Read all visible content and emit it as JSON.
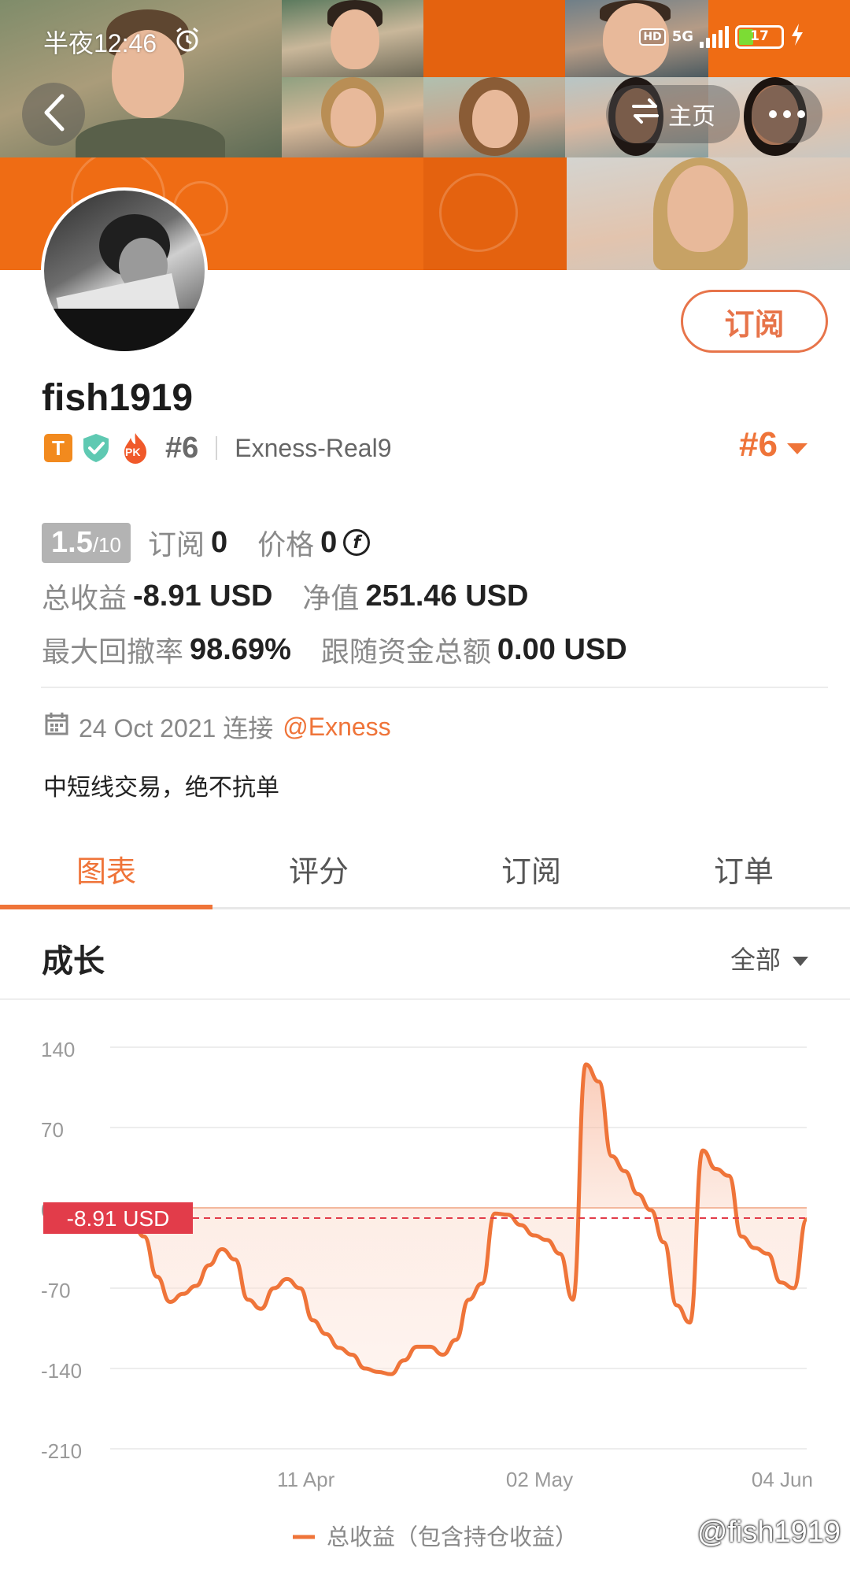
{
  "status_bar": {
    "time": "半夜12:46",
    "network_badge": "HD",
    "network": "5G",
    "battery": "17"
  },
  "nav": {
    "home_label": "主页"
  },
  "profile": {
    "username": "fish1919",
    "badge_t": "T",
    "badge_pk": "PK",
    "rank": "#6",
    "server": "Exness-Real9",
    "rank_big": "#6",
    "subscribe_label": "订阅"
  },
  "stats": {
    "score": "1.5",
    "score_max": "/10",
    "subscriptions_label": "订阅",
    "subscriptions_value": "0",
    "price_label": "价格",
    "price_value": "0",
    "total_profit_label": "总收益",
    "total_profit_value": "-8.91 USD",
    "equity_label": "净值",
    "equity_value": "251.46 USD",
    "max_drawdown_label": "最大回撤率",
    "max_drawdown_value": "98.69%",
    "follow_funds_label": "跟随资金总额",
    "follow_funds_value": "0.00 USD"
  },
  "connect": {
    "date": "24 Oct 2021 连接",
    "broker": "@Exness"
  },
  "bio": "中短线交易，绝不抗单",
  "tabs": [
    {
      "label": "图表",
      "active": true
    },
    {
      "label": "评分",
      "active": false
    },
    {
      "label": "订阅",
      "active": false
    },
    {
      "label": "订单",
      "active": false
    }
  ],
  "section": {
    "title": "成长",
    "range": "全部"
  },
  "chart_data": {
    "type": "area",
    "ylim": [
      -210,
      140
    ],
    "y_ticks": [
      "140",
      "70",
      "0",
      "-70",
      "-140",
      "-210"
    ],
    "x_ticks": [
      "11 Apr",
      "02 May",
      "04 Jun"
    ],
    "current_value_label": "-8.91 USD",
    "current_value": -8.91,
    "legend": "总收益（包含持仓收益）",
    "series": [
      {
        "name": "总收益（包含持仓收益）",
        "values": [
          0,
          -10,
          -25,
          -60,
          -82,
          -75,
          -68,
          -50,
          -36,
          -45,
          -80,
          -88,
          -70,
          -62,
          -70,
          -98,
          -110,
          -122,
          -128,
          -140,
          -143,
          -145,
          -133,
          -121,
          -121,
          -128,
          -115,
          -80,
          -66,
          -5,
          -6,
          -15,
          -24,
          -28,
          -40,
          -80,
          125,
          110,
          45,
          32,
          12,
          -2,
          -30,
          -85,
          -100,
          50,
          34,
          28,
          -25,
          -35,
          -40,
          -65,
          -70,
          -10
        ]
      }
    ],
    "x_positions_ticks": {
      "11 Apr": 0.344,
      "02 May": 0.65,
      "04 Jun": 0.968
    },
    "color": "#ef7439",
    "current_color": "#e23c4a"
  },
  "watermark": "@fish1919"
}
